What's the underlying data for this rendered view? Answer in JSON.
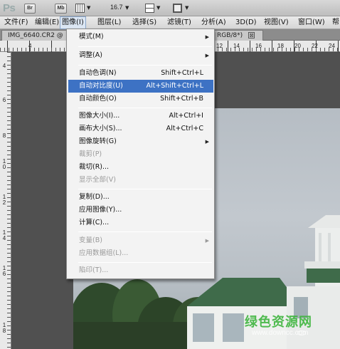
{
  "app": {
    "logo": "Ps",
    "bridge_button": "Br",
    "minibridge_button": "Mb",
    "zoom": "16.7"
  },
  "menubar": {
    "items": [
      "文件(F)",
      "编辑(E)",
      "图像(I)",
      "图层(L)",
      "选择(S)",
      "滤镜(T)",
      "分析(A)",
      "3D(D)",
      "视图(V)",
      "窗口(W)",
      "帮"
    ],
    "active": "图像(I)"
  },
  "document": {
    "tab_title": "IMG_6640.CR2 @",
    "tab_mode": "RGB/8*)",
    "close_glyph": "⊠"
  },
  "rulers": {
    "horizontal": [
      "4",
      "12",
      "14",
      "16",
      "18",
      "20",
      "22",
      "24"
    ],
    "vertical": [
      "4",
      "6",
      "8",
      "1\n0",
      "1\n2",
      "1\n4",
      "1\n6",
      "1\n8"
    ]
  },
  "image_menu": {
    "items": [
      {
        "label": "模式(M)",
        "shortcut": "",
        "submenu": true,
        "disabled": false
      },
      {
        "label": "调整(A)",
        "shortcut": "",
        "submenu": true,
        "disabled": false
      },
      {
        "label": "自动色调(N)",
        "shortcut": "Shift+Ctrl+L",
        "submenu": false,
        "disabled": false
      },
      {
        "label": "自动对比度(U)",
        "shortcut": "Alt+Shift+Ctrl+L",
        "submenu": false,
        "disabled": false,
        "highlighted": true
      },
      {
        "label": "自动颜色(O)",
        "shortcut": "Shift+Ctrl+B",
        "submenu": false,
        "disabled": false
      },
      {
        "label": "图像大小(I)...",
        "shortcut": "Alt+Ctrl+I",
        "submenu": false,
        "disabled": false
      },
      {
        "label": "画布大小(S)...",
        "shortcut": "Alt+Ctrl+C",
        "submenu": false,
        "disabled": false
      },
      {
        "label": "图像旋转(G)",
        "shortcut": "",
        "submenu": true,
        "disabled": false
      },
      {
        "label": "裁剪(P)",
        "shortcut": "",
        "submenu": false,
        "disabled": true
      },
      {
        "label": "裁切(R)...",
        "shortcut": "",
        "submenu": false,
        "disabled": false
      },
      {
        "label": "显示全部(V)",
        "shortcut": "",
        "submenu": false,
        "disabled": true
      },
      {
        "label": "复制(D)...",
        "shortcut": "",
        "submenu": false,
        "disabled": false
      },
      {
        "label": "应用图像(Y)...",
        "shortcut": "",
        "submenu": false,
        "disabled": false
      },
      {
        "label": "计算(C)...",
        "shortcut": "",
        "submenu": false,
        "disabled": false
      },
      {
        "label": "变量(B)",
        "shortcut": "",
        "submenu": true,
        "disabled": true
      },
      {
        "label": "应用数据组(L)...",
        "shortcut": "",
        "submenu": false,
        "disabled": true
      },
      {
        "label": "陷印(T)...",
        "shortcut": "",
        "submenu": false,
        "disabled": true
      }
    ],
    "submenu_glyph": "▶"
  },
  "watermark": {
    "title": "绿色资源网",
    "url": "www.downcc.com"
  },
  "colors": {
    "highlight": "#3d72c4",
    "disabled_text": "#9a9a9a",
    "watermark_green": "#3db53d"
  }
}
